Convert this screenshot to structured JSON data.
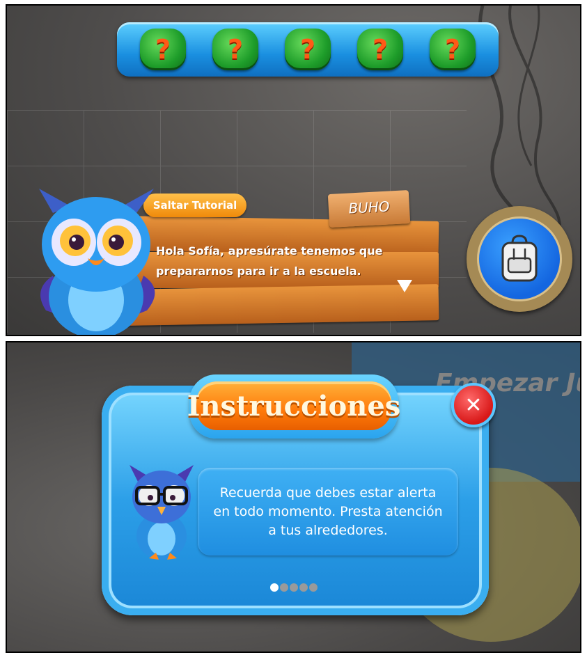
{
  "tutorial": {
    "slots": [
      "?",
      "?",
      "?",
      "?",
      "?"
    ],
    "skip_label": "Saltar Tutorial",
    "speaker": "BUHO",
    "dialog": "Hola Sofía, apresúrate tenemos que prepararnos para ir a la escuela.",
    "inventory_icon": "backpack-icon"
  },
  "instructions": {
    "background_title": "Empezar Jueg",
    "title": "Instrucciones",
    "close_label": "✕",
    "message": "Recuerda que debes estar alerta en todo momento. Presta atención a tus alrededores.",
    "pager": {
      "total": 5,
      "current": 1
    }
  },
  "colors": {
    "slot_green": "#1e9d2a",
    "question_orange": "#ff5a16",
    "modal_blue": "#2c9fe8",
    "title_orange": "#ff7a0a",
    "close_red": "#d81818",
    "wood": "#c87a36"
  }
}
